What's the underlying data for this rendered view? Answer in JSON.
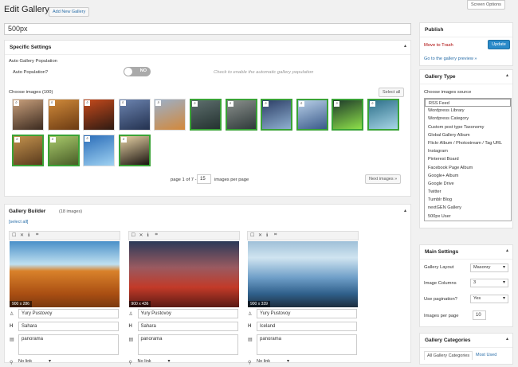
{
  "header": {
    "title": "Edit Gallery",
    "add_new": "Add New Gallery",
    "screen_options": "Screen Options"
  },
  "gallery_title": "500px",
  "specific": {
    "title": "Specific Settings",
    "auto_heading": "Auto Gallery Population",
    "auto_label": "Auto Population?",
    "toggle": "NO",
    "hint": "Check to enable the automatic gallery population",
    "choose": "Choose images (100)",
    "select_all": "Select all",
    "page_text": "page 1 of 7 -",
    "per_page": "15",
    "per_page_label": "images per page",
    "next": "Next images »"
  },
  "builder": {
    "title": "Gallery Builder",
    "count": "(18 images)",
    "select_all": "[select all]",
    "cards": [
      {
        "dim": "900 x 286",
        "author": "Yury Pustovoy",
        "title": "Sahara",
        "desc": "panorama",
        "link": "No link"
      },
      {
        "dim": "900 x 436",
        "author": "Yury Pustovoy",
        "title": "Sahara",
        "desc": "panorama",
        "link": "No link"
      },
      {
        "dim": "900 x 339",
        "author": "Yury Pustovoy",
        "title": "Iceland",
        "desc": "panorama",
        "link": "No link"
      }
    ]
  },
  "publish": {
    "title": "Publish",
    "trash": "Move to Trash",
    "update": "Update",
    "preview": "Go to the gallery preview »"
  },
  "gtype": {
    "title": "Gallery Type",
    "label": "Choose images source",
    "selected": "RSS Feed",
    "options": [
      "Wordpress Library",
      "Wordpress Category",
      "Custom post type Taxonomy",
      "Global Gallery Album",
      "Flickr Album / Photostream / Tag URL",
      "Instagram",
      "Pinterest Board",
      "Facebook Page Album",
      "Google+ Album",
      "Google Drive",
      "Twitter",
      "Tumblr Blog",
      "nextGEN Gallery",
      "500px User"
    ]
  },
  "main": {
    "title": "Main Settings",
    "layout_label": "Gallery Layout",
    "layout": "Masonry",
    "cols_label": "Image Columns",
    "cols": "3",
    "pag_label": "Use pagination?",
    "pag": "Yes",
    "ipp_label": "Images per page",
    "ipp": "10"
  },
  "cats": {
    "title": "Gallery Categories",
    "tab_all": "All Gallery Categories",
    "tab_used": "Most Used"
  },
  "colors": {
    "accent": "#2a8ac9",
    "selected_border": "#3aa336",
    "trash": "#a00"
  }
}
